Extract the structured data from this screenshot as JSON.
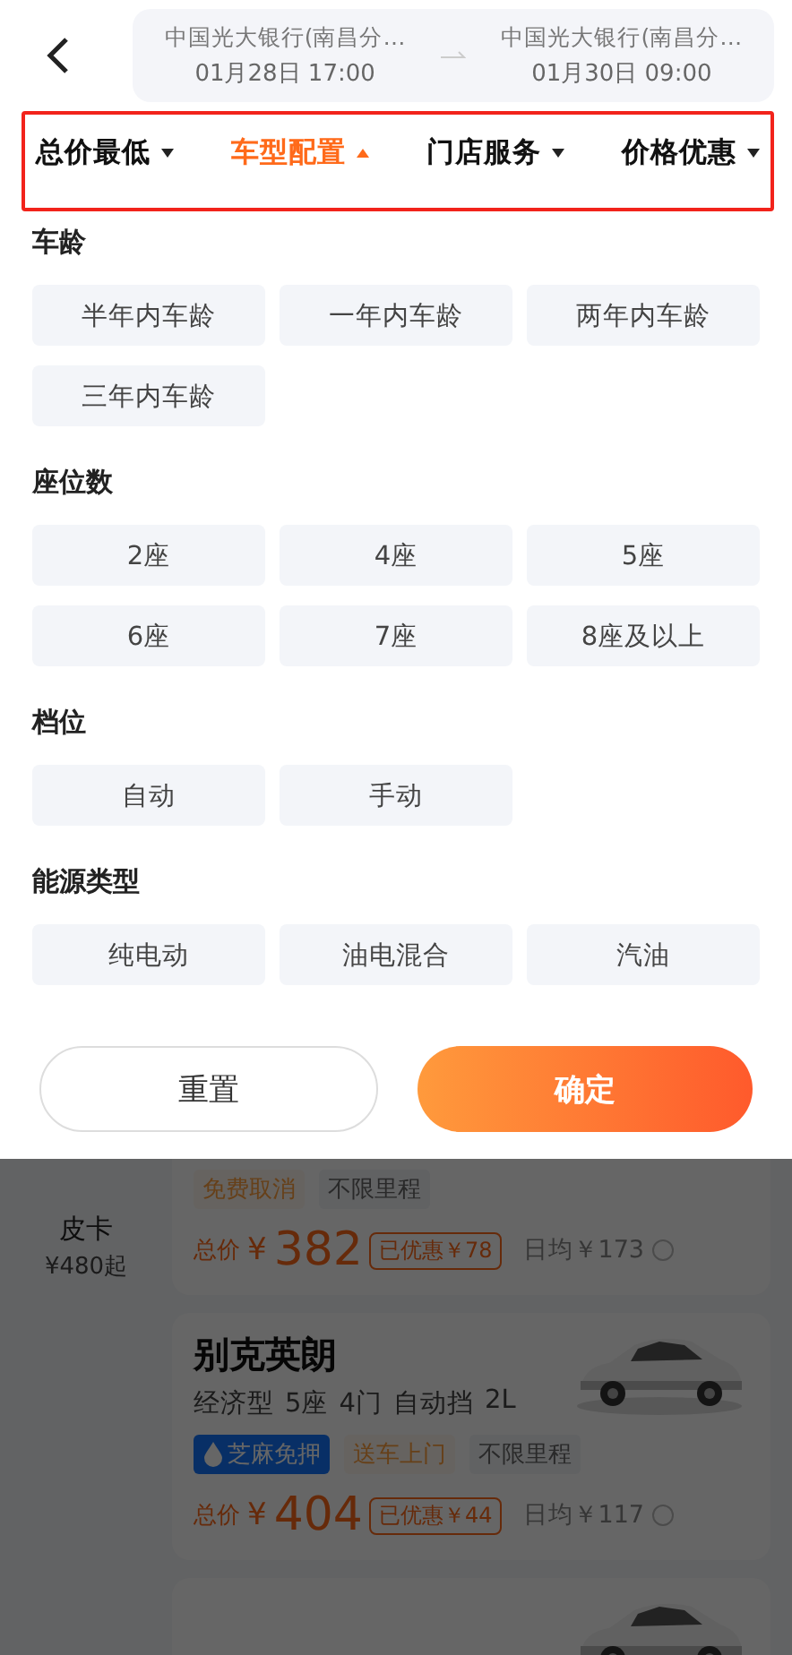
{
  "header": {
    "pickup": {
      "location": "中国光大银行(南昌分…",
      "time": "01月28日 17:00"
    },
    "dropoff": {
      "location": "中国光大银行(南昌分…",
      "time": "01月30日 09:00"
    }
  },
  "filters": [
    {
      "label": "总价最低",
      "selected": false
    },
    {
      "label": "车型配置",
      "selected": true
    },
    {
      "label": "门店服务",
      "selected": false
    },
    {
      "label": "价格优惠",
      "selected": false
    }
  ],
  "sections": [
    {
      "title": "车龄",
      "options": [
        "半年内车龄",
        "一年内车龄",
        "两年内车龄",
        "三年内车龄"
      ]
    },
    {
      "title": "座位数",
      "options": [
        "2座",
        "4座",
        "5座",
        "6座",
        "7座",
        "8座及以上"
      ]
    },
    {
      "title": "档位",
      "options": [
        "自动",
        "手动"
      ]
    },
    {
      "title": "能源类型",
      "options": [
        "纯电动",
        "油电混合",
        "汽油"
      ]
    }
  ],
  "buttons": {
    "reset": "重置",
    "confirm": "确定"
  },
  "categories": [
    {
      "name": "皮卡",
      "price": "¥480起"
    }
  ],
  "cars": [
    {
      "tags": [
        {
          "label": "免费取消",
          "kind": "orange"
        },
        {
          "label": "不限里程",
          "kind": "plain"
        }
      ],
      "price": {
        "prefix": "总价",
        "currency": "¥",
        "amount": "382",
        "discount": "已优惠￥78",
        "daily": "日均￥173"
      }
    },
    {
      "name": "别克英朗",
      "specs": [
        "经济型",
        "5座",
        "4门",
        "自动挡",
        "2L"
      ],
      "picture": true,
      "tags": [
        {
          "label": "芝麻免押",
          "kind": "blue"
        },
        {
          "label": "送车上门",
          "kind": "orange"
        },
        {
          "label": "不限里程",
          "kind": "plain"
        }
      ],
      "price": {
        "prefix": "总价",
        "currency": "¥",
        "amount": "404",
        "discount": "已优惠￥44",
        "daily": "日均￥117"
      }
    },
    {
      "picture": true
    }
  ]
}
